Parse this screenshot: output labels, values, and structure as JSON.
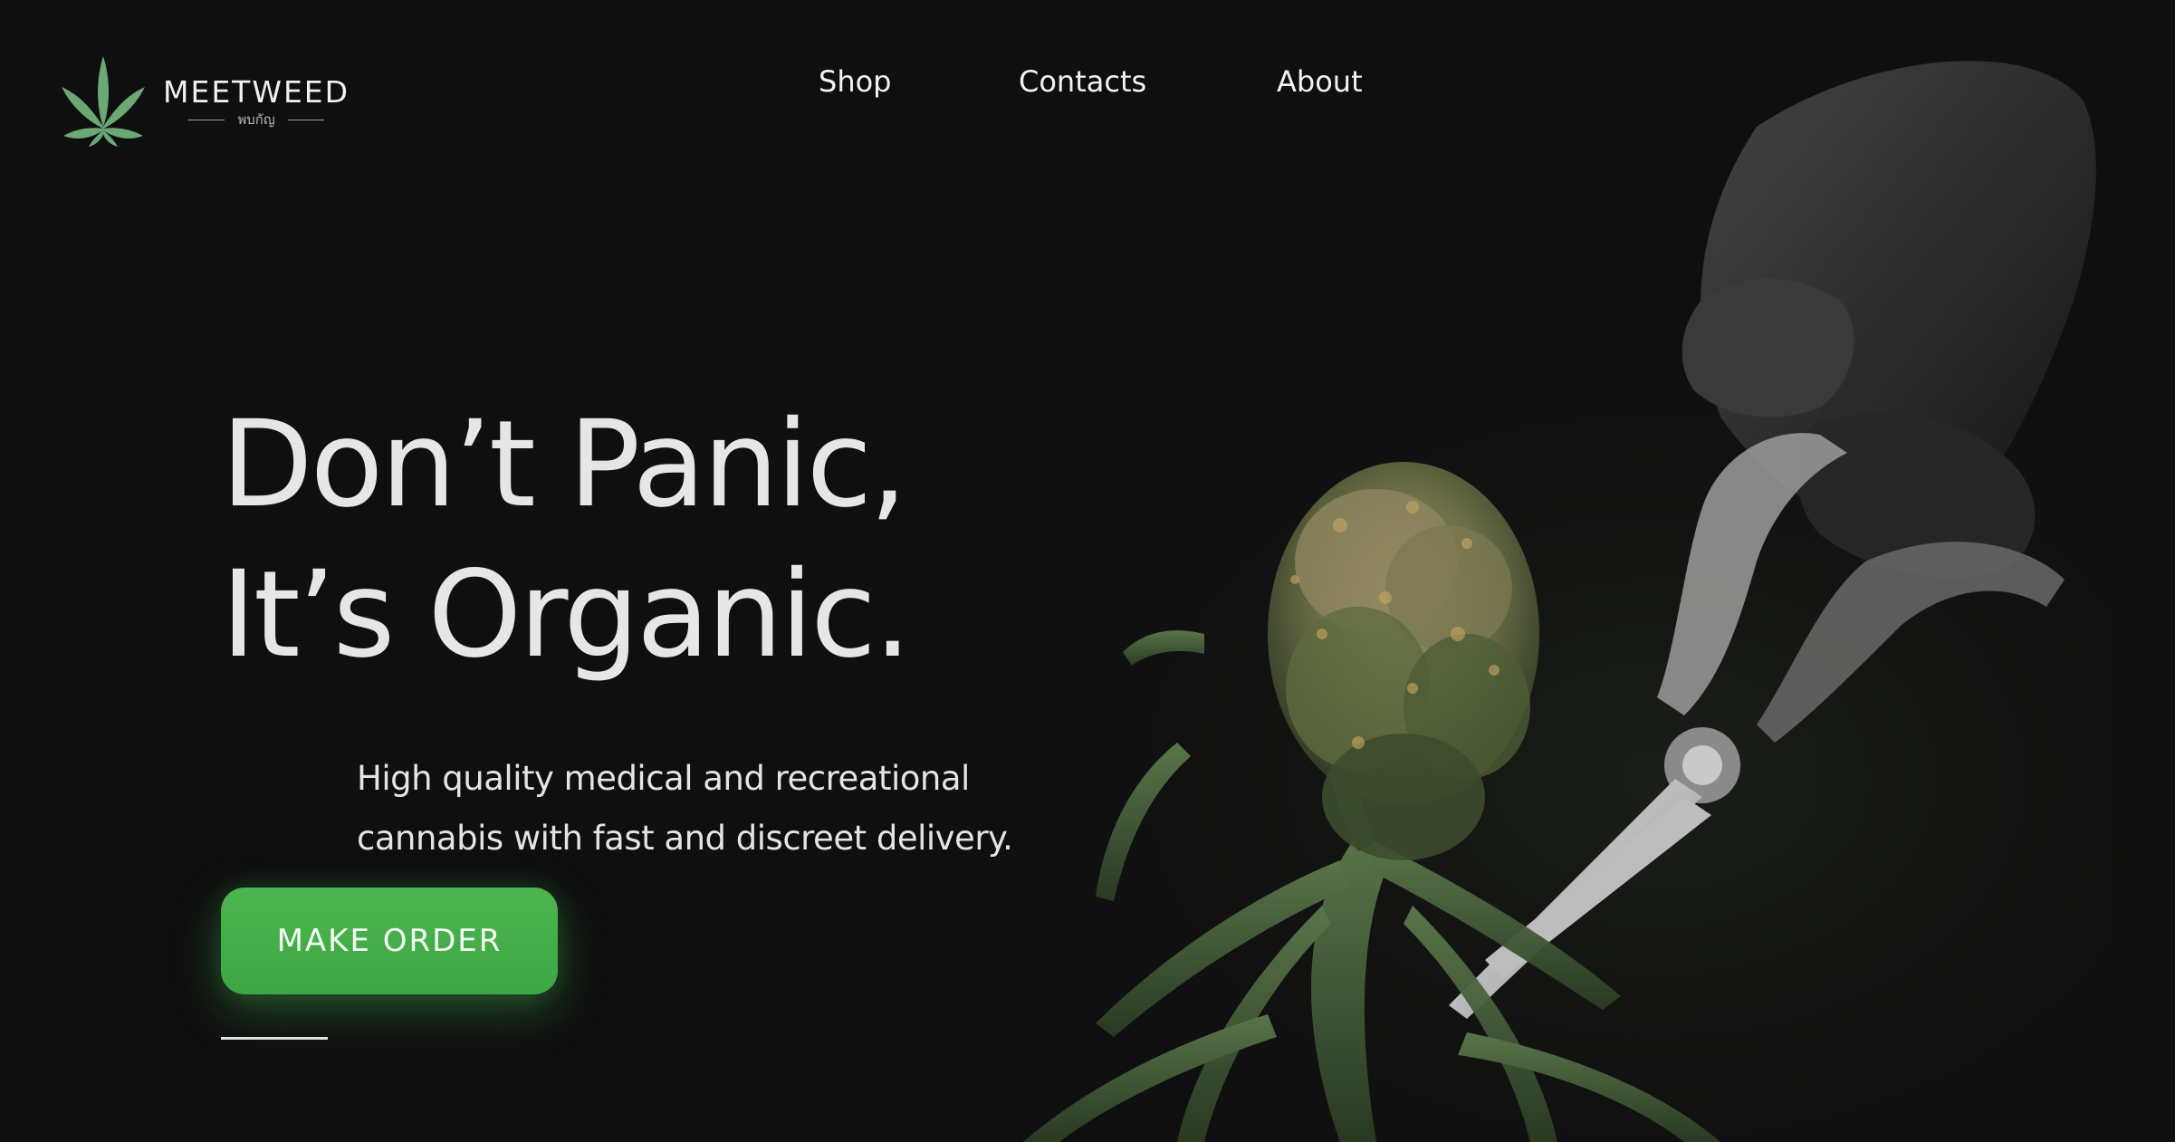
{
  "brand": {
    "name": "MEETWEED",
    "subtitle": "พบกัญ",
    "accent_color": "#4cb550",
    "logo_icon": "cannabis-leaf-icon"
  },
  "nav": {
    "items": [
      {
        "label": "Shop"
      },
      {
        "label": "Contacts"
      },
      {
        "label": "About"
      }
    ]
  },
  "hero": {
    "headline_line1": "Don’t Panic,",
    "headline_line2": "It’s Organic.",
    "tagline_line1": "High quality medical and recreational",
    "tagline_line2": "cannabis with fast and discreet delivery.",
    "cta_label": "MAKE ORDER"
  },
  "colors": {
    "background": "#0f0f0f",
    "text": "#e6e6e6",
    "button": "#4cb550"
  }
}
